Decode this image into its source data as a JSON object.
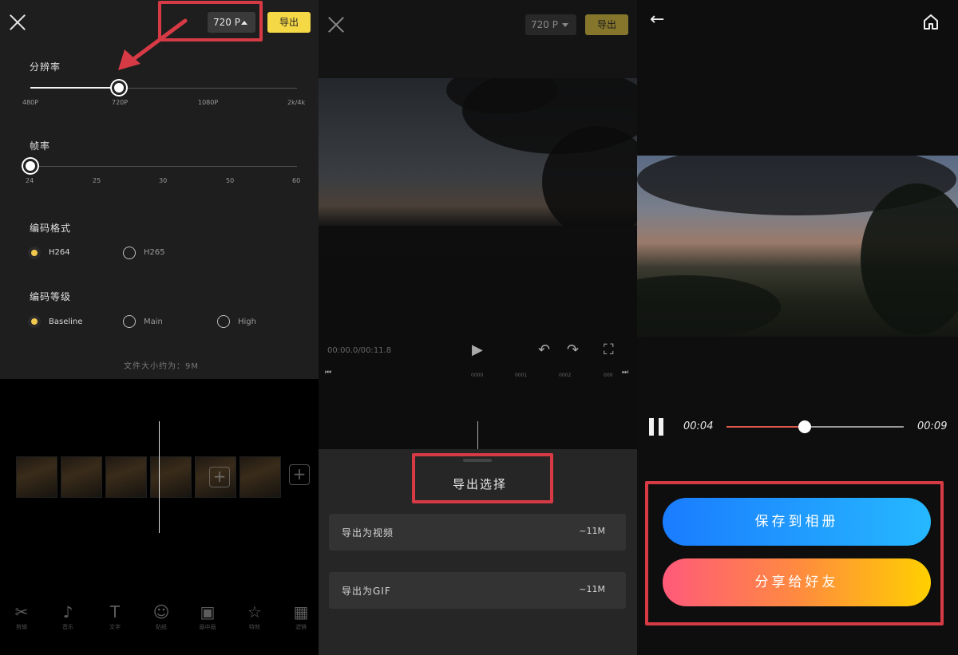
{
  "panel1": {
    "resolution_value": "720 P",
    "export_label": "导出",
    "resolution": {
      "title": "分辨率",
      "ticks": [
        "480P",
        "720P",
        "1080P",
        "2k/4k"
      ],
      "selected": "720P"
    },
    "framerate": {
      "title": "帧率",
      "ticks": [
        "24",
        "25",
        "30",
        "50",
        "60"
      ],
      "selected": "24"
    },
    "codec_format": {
      "title": "编码格式",
      "options": [
        "H264",
        "H265"
      ],
      "selected": "H264"
    },
    "codec_level": {
      "title": "编码等级",
      "options": [
        "Baseline",
        "Main",
        "High"
      ],
      "selected": "Baseline"
    },
    "file_size": "文件大小约为：9M",
    "toolbar": [
      {
        "icon": "scissors-icon",
        "glyph": "✂",
        "label": "剪辑"
      },
      {
        "icon": "music-icon",
        "glyph": "♪",
        "label": "音乐"
      },
      {
        "icon": "text-icon",
        "glyph": "T",
        "label": "文字"
      },
      {
        "icon": "sticker-icon",
        "glyph": "☺",
        "label": "贴纸"
      },
      {
        "icon": "pip-icon",
        "glyph": "▣",
        "label": "画中画"
      },
      {
        "icon": "effect-icon",
        "glyph": "☆",
        "label": "特效"
      },
      {
        "icon": "filter-icon",
        "glyph": "▦",
        "label": "滤镜"
      }
    ]
  },
  "panel2": {
    "resolution_value": "720 P",
    "export_label": "导出",
    "timecode": "00:00.0/00:11.8",
    "scale": [
      "0000",
      "0001",
      "0002",
      "000"
    ],
    "sheet_title": "导出选择",
    "options": [
      {
        "label": "导出为视频",
        "size": "~11M"
      },
      {
        "label": "导出为GIF",
        "size": "~11M"
      }
    ]
  },
  "panel3": {
    "current_time": "00:04",
    "total_time": "00:09",
    "progress": 0.44,
    "save_label": "保存到相册",
    "share_label": "分享给好友"
  },
  "colors": {
    "accent_yellow": "#f5d845",
    "highlight_red": "#d63a45",
    "save_blue": "#1a7cff",
    "share_gradient": [
      "#ff5a7a",
      "#ff8a40",
      "#ffd000"
    ],
    "progress_red": "#e05a4a"
  }
}
